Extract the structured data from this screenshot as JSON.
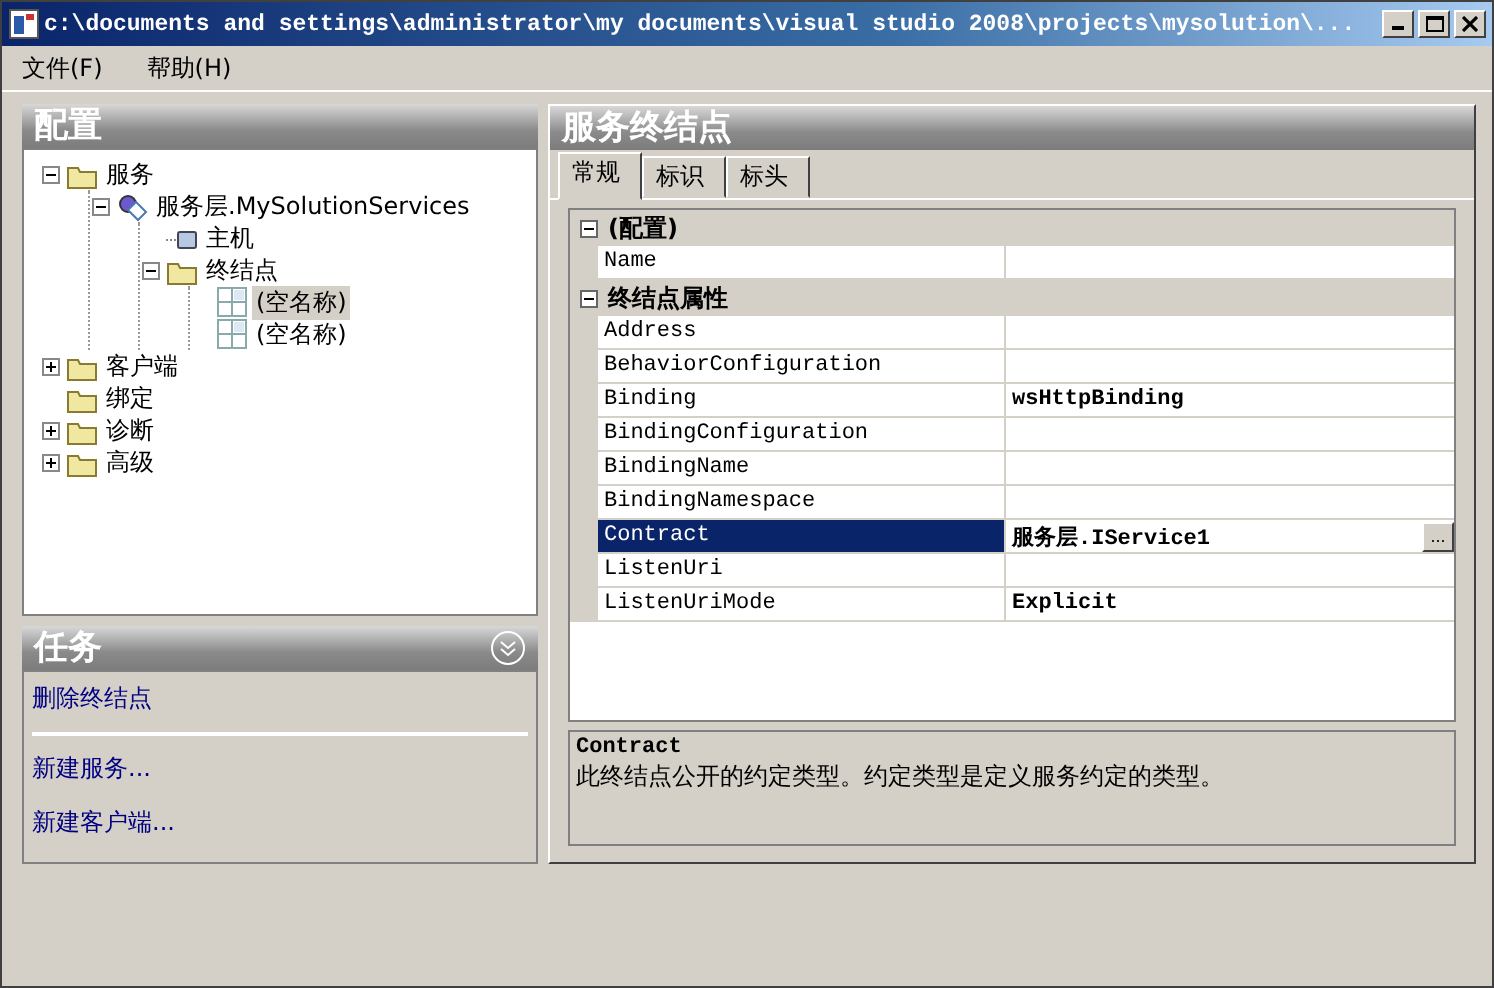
{
  "window": {
    "title": "c:\\documents and settings\\administrator\\my documents\\visual studio 2008\\projects\\mysolution\\..."
  },
  "menu": [
    {
      "label": "文件(F)"
    },
    {
      "label": "帮助(H)"
    }
  ],
  "config_panel": {
    "title": "配置",
    "tree": [
      {
        "label": "服务",
        "kind": "folder",
        "expanded": true,
        "selected": false,
        "children": [
          {
            "label": "服务层.MySolutionServices",
            "kind": "service",
            "expanded": true,
            "selected": false,
            "children": [
              {
                "label": "主机",
                "kind": "host",
                "selected": false
              },
              {
                "label": "终结点",
                "kind": "folder",
                "expanded": true,
                "selected": false,
                "children": [
                  {
                    "label": "(空名称)",
                    "kind": "endpoint",
                    "selected": true
                  },
                  {
                    "label": "(空名称)",
                    "kind": "endpoint",
                    "selected": false
                  }
                ]
              }
            ]
          }
        ]
      },
      {
        "label": "客户端",
        "kind": "folder",
        "expanded": false,
        "selected": false
      },
      {
        "label": "绑定",
        "kind": "folder",
        "selected": false
      },
      {
        "label": "诊断",
        "kind": "folder",
        "expanded": false,
        "selected": false
      },
      {
        "label": "高级",
        "kind": "folder",
        "expanded": false,
        "selected": false
      }
    ]
  },
  "tasks_panel": {
    "title": "任务",
    "sections": [
      {
        "items": [
          "删除终结点"
        ]
      },
      {
        "items": [
          "新建服务...",
          "新建客户端..."
        ]
      }
    ]
  },
  "endpoint_panel": {
    "title": "服务终结点",
    "tabs": [
      {
        "label": "常规",
        "selected": true
      },
      {
        "label": "标识",
        "selected": false
      },
      {
        "label": "标头",
        "selected": false
      }
    ],
    "property_grid": {
      "categories": [
        {
          "label": "(配置)",
          "expanded": true,
          "properties": [
            {
              "name": "Name",
              "selected": false
            }
          ]
        },
        {
          "label": "终结点属性",
          "expanded": true,
          "properties": [
            {
              "name": "Address",
              "selected": false
            },
            {
              "name": "BehaviorConfiguration",
              "selected": false
            },
            {
              "name": "Binding",
              "value": "wsHttpBinding",
              "selected": false,
              "modified": true
            },
            {
              "name": "BindingConfiguration",
              "selected": false
            },
            {
              "name": "BindingName",
              "selected": false
            },
            {
              "name": "BindingNamespace",
              "selected": false
            },
            {
              "name": "Contract",
              "value": "服务层.IService1",
              "selected": true,
              "modified": true,
              "button": "..."
            },
            {
              "name": "ListenUri",
              "selected": false
            },
            {
              "name": "ListenUriMode",
              "value": "Explicit",
              "selected": false,
              "modified": true
            }
          ]
        }
      ]
    },
    "description": {
      "title": "Contract",
      "text": "此终结点公开的约定类型。约定类型是定义服务约定的类型。"
    }
  }
}
